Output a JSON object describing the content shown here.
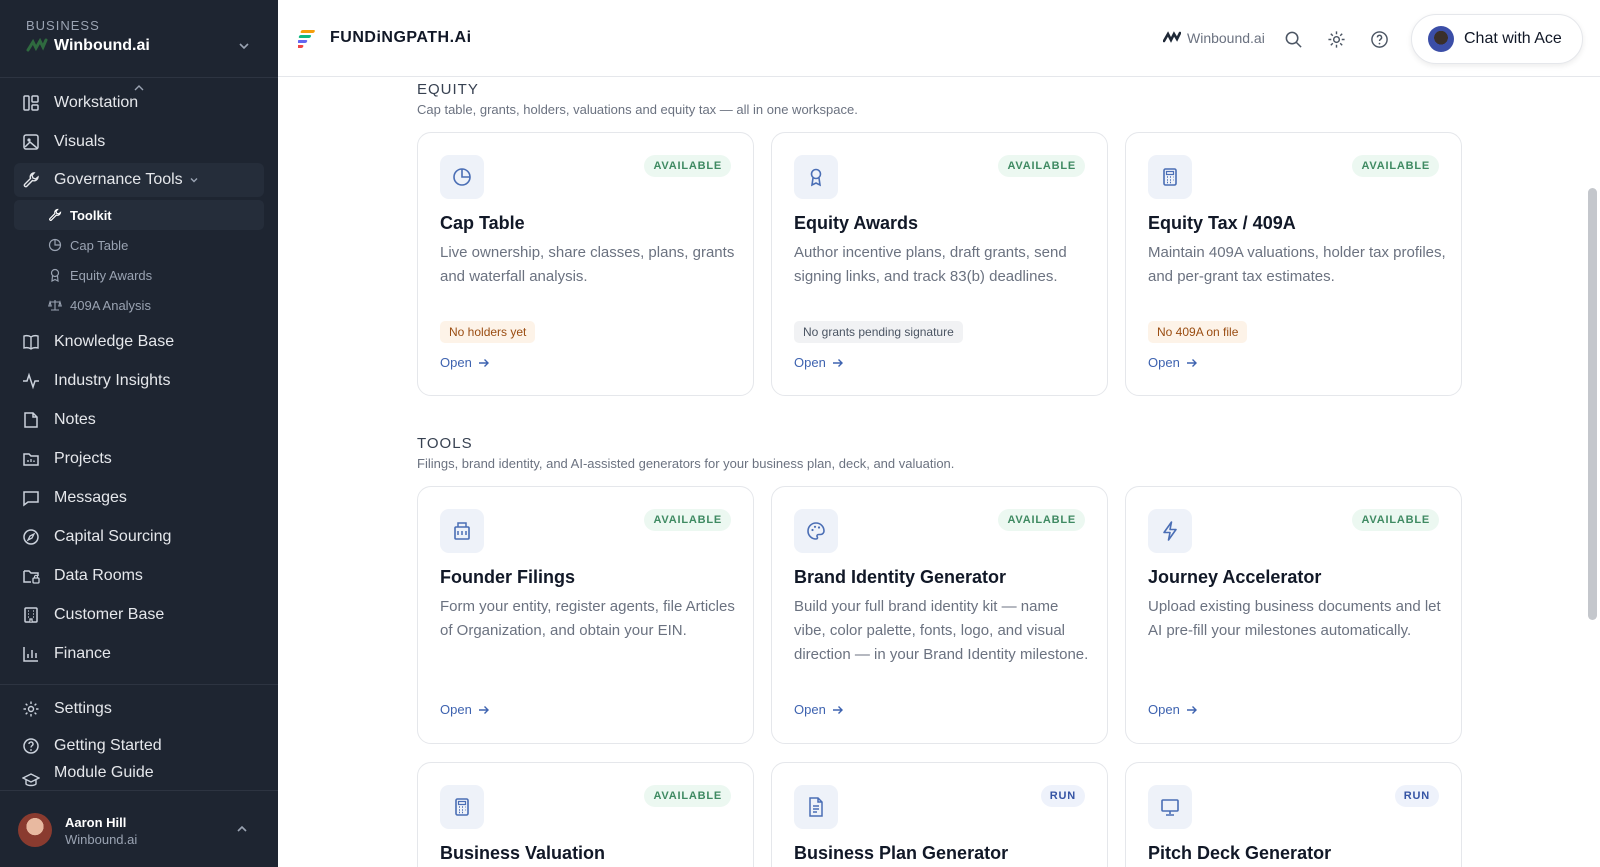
{
  "sidebar": {
    "business_caption": "BUSINESS",
    "business_name": "Winbound.ai",
    "nav": [
      {
        "label": "Workstation",
        "icon": "workstation-icon"
      },
      {
        "label": "Visuals",
        "icon": "image-icon"
      },
      {
        "label": "Governance Tools",
        "icon": "wrench-icon"
      },
      {
        "label": "Knowledge Base",
        "icon": "book-icon"
      },
      {
        "label": "Industry Insights",
        "icon": "pulse-icon"
      },
      {
        "label": "Notes",
        "icon": "note-icon"
      },
      {
        "label": "Projects",
        "icon": "folder-icon"
      },
      {
        "label": "Messages",
        "icon": "message-icon"
      },
      {
        "label": "Capital Sourcing",
        "icon": "compass-icon"
      },
      {
        "label": "Data Rooms",
        "icon": "folder-lock-icon"
      },
      {
        "label": "Customer Base",
        "icon": "building-icon"
      },
      {
        "label": "Finance",
        "icon": "bar-chart-icon"
      },
      {
        "label": "Settings",
        "icon": "gear-icon"
      },
      {
        "label": "Getting Started",
        "icon": "help-circle-icon"
      },
      {
        "label": "Module Guide",
        "icon": "graduation-cap-icon"
      }
    ],
    "sub": [
      {
        "label": "Toolkit",
        "icon": "wrench-icon"
      },
      {
        "label": "Cap Table",
        "icon": "pie-chart-icon"
      },
      {
        "label": "Equity Awards",
        "icon": "award-icon"
      },
      {
        "label": "409A Analysis",
        "icon": "scale-icon"
      }
    ],
    "user": {
      "name": "Aaron Hill",
      "org": "Winbound.ai"
    }
  },
  "topbar": {
    "brand": "FUNDiNGPATH.Ai",
    "org": "Winbound.ai",
    "chat_label": "Chat with Ace"
  },
  "sections": {
    "equity": {
      "title": "EQUITY",
      "subtitle": "Cap table, grants, holders, valuations and equity tax — all in one workspace."
    },
    "tools": {
      "title": "TOOLS",
      "subtitle": "Filings, brand identity, and AI-assisted generators for your business plan, deck, and valuation."
    }
  },
  "cards": [
    {
      "title": "Cap Table",
      "desc": "Live ownership, share classes, plans, grants and waterfall analysis.",
      "badge": "AVAILABLE",
      "pill": "No holders yet",
      "open": "Open",
      "icon": "pie-chart-icon"
    },
    {
      "title": "Equity Awards",
      "desc": "Author incentive plans, draft grants, send signing links, and track 83(b) deadlines.",
      "badge": "AVAILABLE",
      "pill": "No grants pending signature",
      "open": "Open",
      "icon": "award-icon"
    },
    {
      "title": "Equity Tax / 409A",
      "desc": "Maintain 409A valuations, holder tax profiles, and per-grant tax estimates.",
      "badge": "AVAILABLE",
      "pill": "No 409A on file",
      "open": "Open",
      "icon": "calculator-icon"
    },
    {
      "title": "Founder Filings",
      "desc": "Form your entity, register agents, file Articles of Organization, and obtain your EIN.",
      "badge": "AVAILABLE",
      "open": "Open",
      "icon": "building-icon"
    },
    {
      "title": "Brand Identity Generator",
      "desc": "Build your full brand identity kit — name vibe, color palette, fonts, logo, and visual direction — in your Brand Identity milestone.",
      "badge": "AVAILABLE",
      "open": "Open",
      "icon": "palette-icon"
    },
    {
      "title": "Journey Accelerator",
      "desc": "Upload existing business documents and let AI pre-fill your milestones automatically.",
      "badge": "AVAILABLE",
      "open": "Open",
      "icon": "lightning-icon"
    },
    {
      "title": "Business Valuation",
      "badge": "AVAILABLE",
      "icon": "calculator-icon"
    },
    {
      "title": "Business Plan Generator",
      "badge": "RUN",
      "icon": "document-icon"
    },
    {
      "title": "Pitch Deck Generator",
      "badge": "RUN",
      "icon": "presentation-icon"
    }
  ],
  "colors": {
    "sidebar_bg": "#1e2531",
    "accent": "#3e63b0",
    "available": "#3f8a62",
    "run": "#3554a4"
  }
}
